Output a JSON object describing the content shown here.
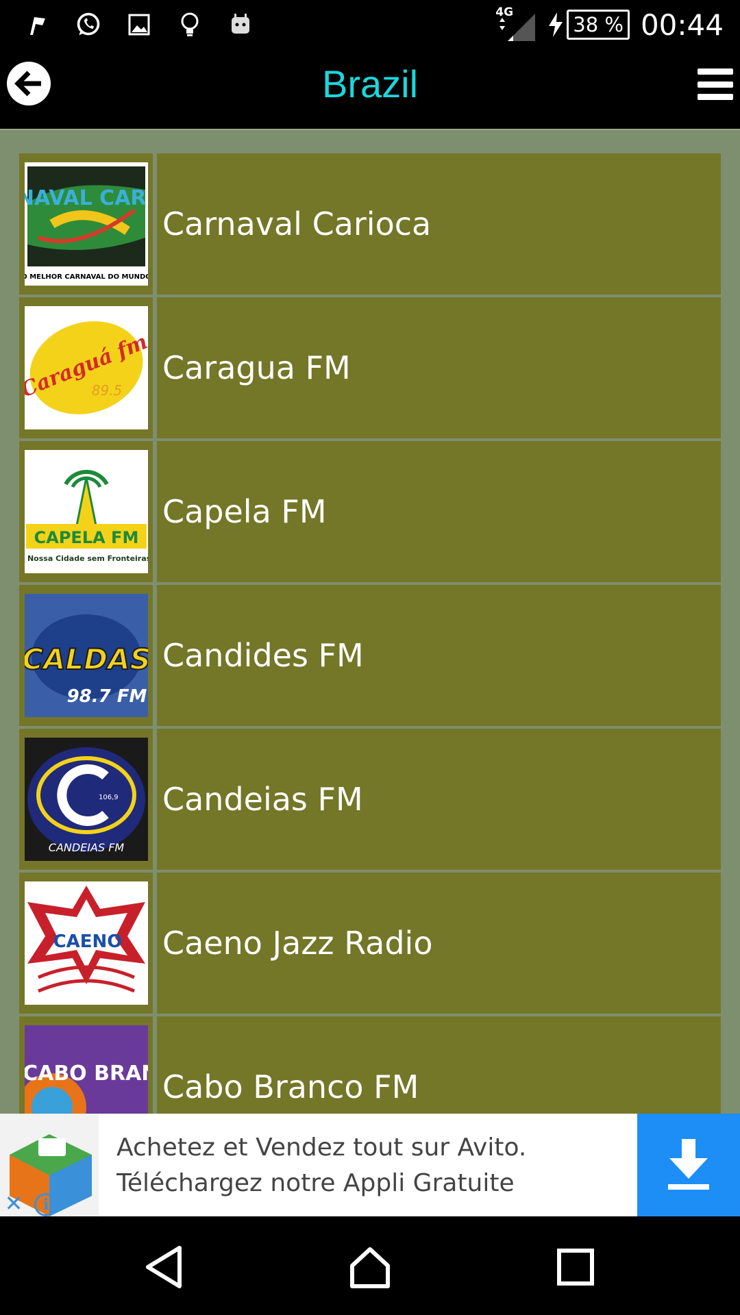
{
  "status_bar": {
    "network_type": "4G",
    "battery": "38 %",
    "time": "00:44",
    "icons": [
      "flag-icon",
      "whatsapp-icon",
      "gallery-icon",
      "lightbulb-icon",
      "android-icon",
      "signal-icon",
      "charging-icon",
      "battery-icon"
    ]
  },
  "app_bar": {
    "title": "Brazil",
    "back_icon": "back-arrow-icon",
    "menu_icon": "hamburger-menu-icon",
    "title_color": "#19d8dc"
  },
  "stations": [
    {
      "name": "Carnaval Carioca",
      "logo_icon": "carnaval-carioca-logo",
      "logo_text": "CARNAVAL CARIOCA",
      "logo_subtext": "O MELHOR CARNAVAL DO MUNDO"
    },
    {
      "name": "Caragua FM",
      "logo_icon": "caragua-fm-logo",
      "logo_text": "Caraguá fm",
      "logo_subtext": "89.5"
    },
    {
      "name": "Capela FM",
      "logo_icon": "capela-fm-logo",
      "logo_text": "CAPELA FM",
      "logo_subtext": "A Nossa Cidade sem Fronteiras."
    },
    {
      "name": "Candides FM",
      "logo_icon": "radio-caldas-logo",
      "logo_text": "CALDAS",
      "logo_subtext": "98.7 FM"
    },
    {
      "name": "Candeias FM",
      "logo_icon": "candeias-fm-logo",
      "logo_text": "CANDEIAS FM",
      "logo_subtext": "106,9"
    },
    {
      "name": "Caeno Jazz Radio",
      "logo_icon": "caeno-logo",
      "logo_text": "CAENO",
      "logo_subtext": ""
    },
    {
      "name": "Cabo Branco FM",
      "logo_icon": "cabo-branco-logo",
      "logo_text": "CABO BRANCO",
      "logo_subtext": ""
    }
  ],
  "ad": {
    "line1": "Achetez et Vendez tout sur Avito.",
    "line2": "Téléchargez notre Appli Gratuite",
    "download_icon": "download-icon",
    "close_icon": "close-icon",
    "info_icon": "info-icon",
    "accent_color": "#1d8ef5"
  },
  "nav_bar": {
    "icons": [
      "back-triangle-icon",
      "home-icon",
      "recents-square-icon"
    ]
  },
  "colors": {
    "list_background": "#7e8f6f",
    "row_background": "#747628"
  }
}
